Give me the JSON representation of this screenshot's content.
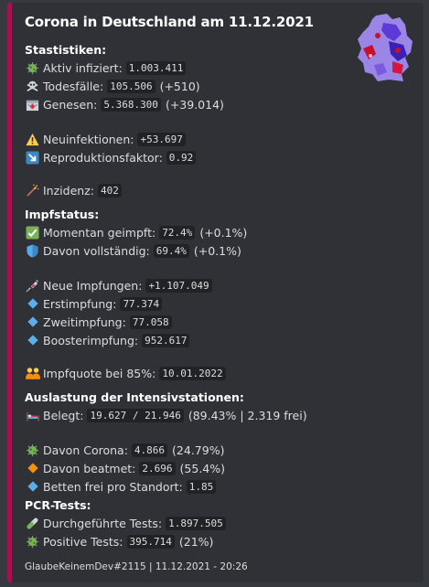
{
  "title": "Corona in Deutschland am 11.12.2021",
  "sections": {
    "statistiken": "Stastistiken:",
    "impfstatus": "Impfstatus:",
    "intensiv": "Auslastung der Intensivstationen:",
    "pcr": "PCR-Tests:"
  },
  "lines": {
    "aktiv": {
      "label": "Aktiv infiziert:",
      "value": "1.003.411"
    },
    "tode": {
      "label": "Todesfälle:",
      "value": "105.506",
      "extra": "(+510)"
    },
    "genesen": {
      "label": "Genesen:",
      "value": "5.368.300",
      "extra": "(+39.014)"
    },
    "neu": {
      "label": "Neuinfektionen:",
      "value": "+53.697"
    },
    "repro": {
      "label": "Reproduktionsfaktor:",
      "value": "0.92"
    },
    "inzidenz": {
      "label": "Inzidenz:",
      "value": "402"
    },
    "momentan": {
      "label": "Momentan geimpft:",
      "value": "72.4%",
      "extra": "(+0.1%)"
    },
    "vollstaendig": {
      "label": "Davon vollständig:",
      "value": "69.4%",
      "extra": "(+0.1%)"
    },
    "neueimpf": {
      "label": "Neue Impfungen:",
      "value": "+1.107.049"
    },
    "erst": {
      "label": "Erstimpfung:",
      "value": "77.374"
    },
    "zweit": {
      "label": "Zweitimpfung:",
      "value": "77.058"
    },
    "booster": {
      "label": "Boosterimpfung:",
      "value": "952.617"
    },
    "quote": {
      "label": "Impfquote bei 85%:",
      "value": "10.01.2022"
    },
    "belegt": {
      "label": "Belegt:",
      "value": "19.627 / 21.946",
      "extra": "(89.43% | 2.319 frei)"
    },
    "corona": {
      "label": "Davon Corona:",
      "value": "4.866",
      "extra": "(24.79%)"
    },
    "beatmet": {
      "label": "Davon beatmet:",
      "value": "2.696",
      "extra": "(55.4%)"
    },
    "betten": {
      "label": "Betten frei pro Standort:",
      "value": "1.85"
    },
    "tests": {
      "label": "Durchgeführte Tests:",
      "value": "1.897.505"
    },
    "positive": {
      "label": "Positive Tests:",
      "value": "395.714",
      "extra": "(21%)"
    }
  },
  "icons": {
    "microbe": "microbe-icon",
    "skull": "skull-crossbones-icon",
    "hospital": "hospital-icon",
    "warning": "warning-icon",
    "arrow": "arrow-down-right-icon",
    "wand": "magic-wand-icon",
    "check": "check-mark-icon",
    "shield": "shield-icon",
    "syringe": "syringe-icon",
    "diamond_blue": "blue-diamond-icon",
    "diamond_orange": "orange-diamond-icon",
    "people": "people-hugging-icon",
    "bed": "bed-icon",
    "testtube": "test-tube-icon"
  },
  "colors": {
    "accent": "#a6124f",
    "background": "#2f3136",
    "code_bg": "#202225",
    "blue_diamond": "#5dadec",
    "orange_diamond": "#f4900c"
  },
  "footer": "GlaubeKeinemDev#2115 | 11.12.2021 - 20:26"
}
